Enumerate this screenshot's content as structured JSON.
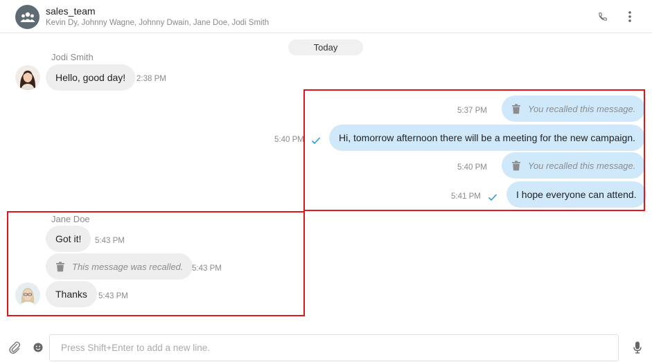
{
  "header": {
    "group_name": "sales_team",
    "members": "Kevin Dy, Johnny Wagne, Johnny Dwain, Jane Doe, Jodi Smith"
  },
  "date_divider": "Today",
  "messages": {
    "m1": {
      "sender": "Jodi Smith",
      "text": "Hello, good day!",
      "time": "2:38 PM"
    },
    "m2": {
      "text": "You recalled this message.",
      "time": "5:37 PM"
    },
    "m3": {
      "text": "Hi, tomorrow afternoon there will be a meeting for the new campaign.",
      "time": "5:40 PM",
      "status": "sent"
    },
    "m4": {
      "text": "You recalled this message.",
      "time": "5:40 PM"
    },
    "m5": {
      "text": "I hope everyone can attend.",
      "time": "5:41 PM",
      "status": "sent"
    },
    "m6": {
      "sender": "Jane Doe",
      "text": "Got it!",
      "time": "5:43 PM"
    },
    "m7": {
      "text": "This message was recalled.",
      "time": "5:43 PM"
    },
    "m8": {
      "text": "Thanks",
      "time": "5:43 PM"
    }
  },
  "composer": {
    "placeholder": "Press Shift+Enter to add a new line.",
    "value": ""
  },
  "icons": {
    "group": "group-icon",
    "call": "phone-icon",
    "more": "more-vertical-icon",
    "recalled": "trash-icon",
    "sent": "check-icon",
    "attach": "paperclip-icon",
    "emoji": "emoji-icon",
    "mic": "microphone-icon"
  },
  "colors": {
    "outgoing_bubble": "#cfe9fb",
    "incoming_bubble": "#eeeeee",
    "check": "#2a9bd8",
    "highlight_box": "#e3121b"
  }
}
